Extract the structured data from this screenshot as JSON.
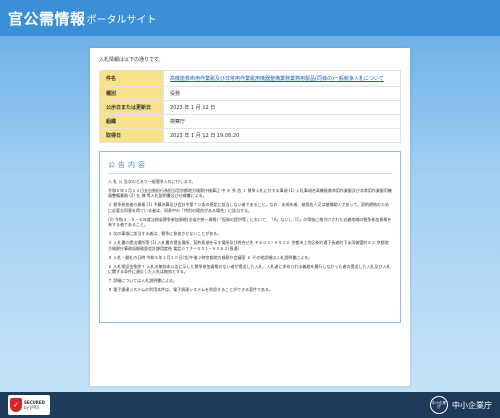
{
  "header": {
    "logo_main": "官公需情報",
    "logo_sub": "ポータルサイト"
  },
  "card": {
    "intro": "入札情報は以下の通りです。",
    "table": [
      {
        "label": "件名",
        "value": "高機能救命用作業艇及び非常用作業艇用機器整備業務業務用製品(同様の)一般競争入札について",
        "is_link": true
      },
      {
        "label": "種別",
        "value": "役務",
        "is_link": false
      },
      {
        "label": "公示日または更新日",
        "value": "2023 年 1 月 12 日",
        "is_link": false
      },
      {
        "label": "組織",
        "value": "検察庁",
        "is_link": false
      },
      {
        "label": "取得日",
        "value": "2023 年 1 月 12 日 19:08:20",
        "is_link": false
      }
    ]
  },
  "notice": {
    "title": "公告内容",
    "paragraphs": [
      "入 札 公 告次のとおり一般競争入札に付します。",
      "令和５年１月１２日支出負担行為担当官京都地方検察庁検事正 中 川 秀 信 １ 競争入札に付する事項 (1) 入札事項名高機能救命用作業艇及び非常用作業艇用機器整備業務 (2) 仕 様 等入札説明書及び仕様書による。",
      "２ 競争参加者の資格 (1) 予算決算及び会計令第７０条の規定に該当しない者であること。なお、未成年者、被保佐人又は被補助人であって、契約締結のために必要な同意を得ている者は、同条中の「特別の理由がある場合」に該当する。",
      "(2) 令和４・５・６年度法務省競争参加資格(全省庁統一資格)「役務の提供等」において、「A」ないし「C」の等級に格付けされた近畿地域の競争参加資格を有する者であること。",
      "３ 次の事項に該当する者は、競争に参加させないことがある。",
      "４ 入札書の提出場所等 (1) 入札書の提出場所、契約条項を示す場所及び問合せ先 〒６０２−８５１０ 京都市上京区新町通下長者町下る両御霊町８２ 京都地方検察庁事務局総務部会計課用度係 電話０７５−４４１−９２６２(直通)",
      "５ 入札・開札の日時 令和５年２月１０日(金)午後２時京都地方検察庁会議室 ６ その他詳細は入札説明書による。",
      "６ 入札保証金免除７ 入札の無効本公告に示した競争参加資格のない者が提出した入札、入札者に求められる義務を履行しなかった者の提出した入札及び入札に関する条件に違反した入札は無効とする。",
      "７ 詳細については入札説明書による。",
      "８ 電子調達システムの利用本件は、電子調達システムを利用することができる案件である。"
    ]
  },
  "footer": {
    "secured_badge_line1": "SECURED",
    "secured_badge_line2": "by JPRS",
    "chusho_mark_label": "中小企業庁",
    "chusho_text": "中小企業庁"
  }
}
